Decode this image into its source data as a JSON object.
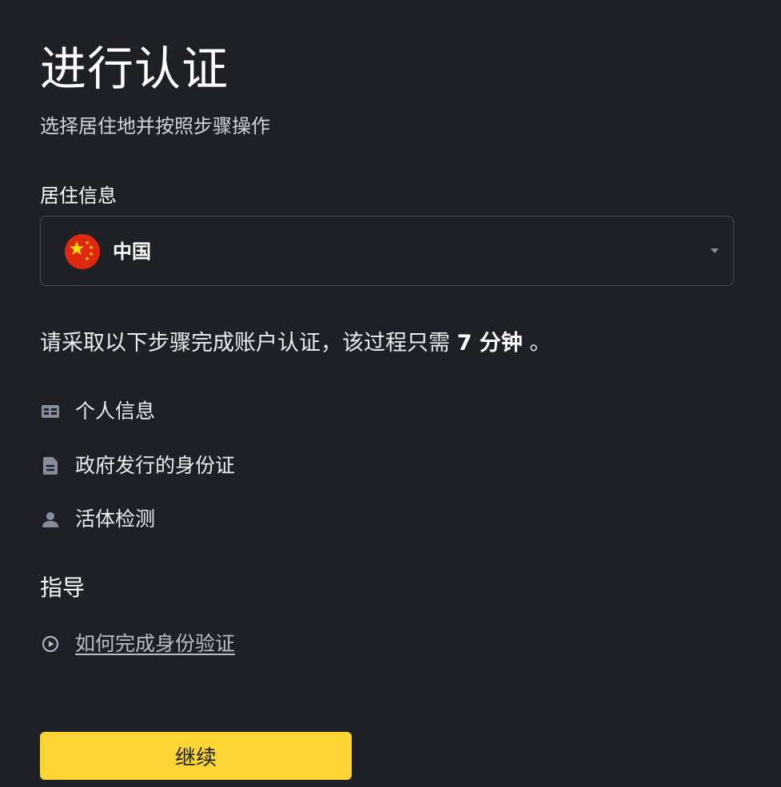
{
  "header": {
    "title": "进行认证",
    "subtitle": "选择居住地并按照步骤操作"
  },
  "residence": {
    "label": "居住信息",
    "selected_country": "中国",
    "flag_icon": "china-flag-icon"
  },
  "intro": {
    "text_before": "请采取以下步骤完成账户认证，该过程只需 ",
    "duration": "7 分钟",
    "text_after": " 。"
  },
  "steps": [
    {
      "label": "个人信息",
      "icon": "id-card-icon"
    },
    {
      "label": "政府发行的身份证",
      "icon": "document-icon"
    },
    {
      "label": "活体检测",
      "icon": "user-icon"
    }
  ],
  "guide": {
    "title": "指导",
    "link_label": "如何完成身份验证",
    "link_icon": "play-circle-icon"
  },
  "actions": {
    "continue_label": "继续"
  },
  "colors": {
    "background": "#1e2026",
    "accent": "#fcd535",
    "border": "#474d57",
    "muted_icon": "#848e9c",
    "flag_red": "#de2910",
    "flag_yellow": "#ffde00"
  }
}
